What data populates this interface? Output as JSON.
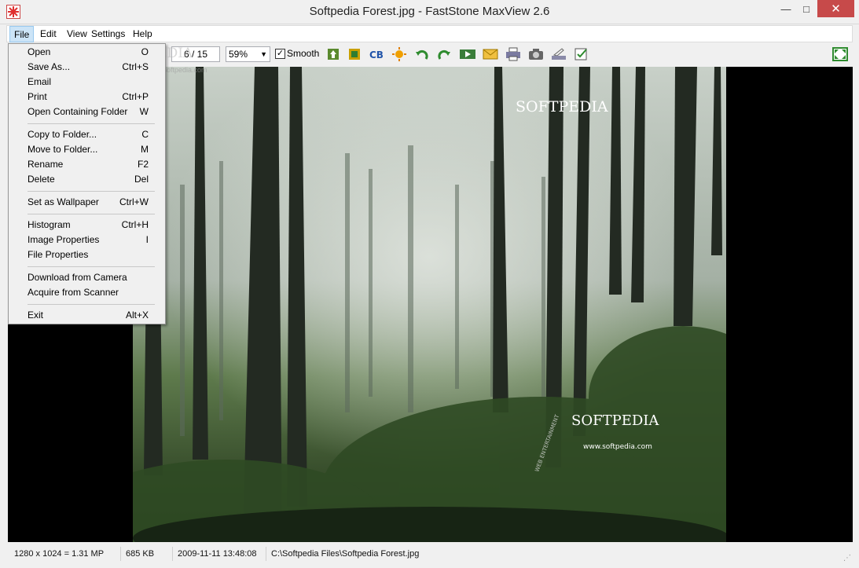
{
  "window": {
    "title": "Softpedia Forest.jpg - FastStone MaxView 2.6",
    "minimize_glyph": "—",
    "maximize_glyph": "□",
    "close_glyph": "✕"
  },
  "menubar": {
    "items": [
      "File",
      "Edit",
      "View",
      "Settings",
      "Help"
    ]
  },
  "toolbar": {
    "counter": "6 / 15",
    "zoom": "59%",
    "smooth_label": "Smooth",
    "smooth_checked": true
  },
  "file_menu": {
    "items": [
      {
        "label": "Open",
        "shortcut": "O"
      },
      {
        "label": "Save As...",
        "shortcut": "Ctrl+S"
      },
      {
        "label": "Email",
        "shortcut": ""
      },
      {
        "label": "Print",
        "shortcut": "Ctrl+P"
      },
      {
        "label": "Open Containing Folder",
        "shortcut": "W"
      },
      {
        "label": "Copy to Folder...",
        "shortcut": "C"
      },
      {
        "label": "Move to Folder...",
        "shortcut": "M"
      },
      {
        "label": "Rename",
        "shortcut": "F2"
      },
      {
        "label": "Delete",
        "shortcut": "Del"
      },
      {
        "label": "Set as Wallpaper",
        "shortcut": "Ctrl+W"
      },
      {
        "label": "Histogram",
        "shortcut": "Ctrl+H"
      },
      {
        "label": "Image Properties",
        "shortcut": "I"
      },
      {
        "label": "File Properties",
        "shortcut": ""
      },
      {
        "label": "Download from Camera",
        "shortcut": ""
      },
      {
        "label": "Acquire from Scanner",
        "shortcut": ""
      },
      {
        "label": "Exit",
        "shortcut": "Alt+X"
      }
    ]
  },
  "image": {
    "watermark_top": "SOFTPEDIA",
    "watermark_bottom": "SOFTPEDIA",
    "watermark_url": "www.softpedia.com",
    "watermark_arc": "WEB ENTERTAINMENT",
    "ghost_logo": "SOFTPEDIA",
    "ghost_url": "www.softpedia.com"
  },
  "statusbar": {
    "dimensions": "1280 x 1024 = 1.31 MP",
    "size": "685 KB",
    "datetime": "2009-11-11 13:48:08",
    "path": "C:\\Softpedia Files\\Softpedia Forest.jpg"
  },
  "colors": {
    "close_button": "#c74a4a",
    "menu_highlight": "#cce4f7",
    "viewer_bg": "#000000"
  }
}
